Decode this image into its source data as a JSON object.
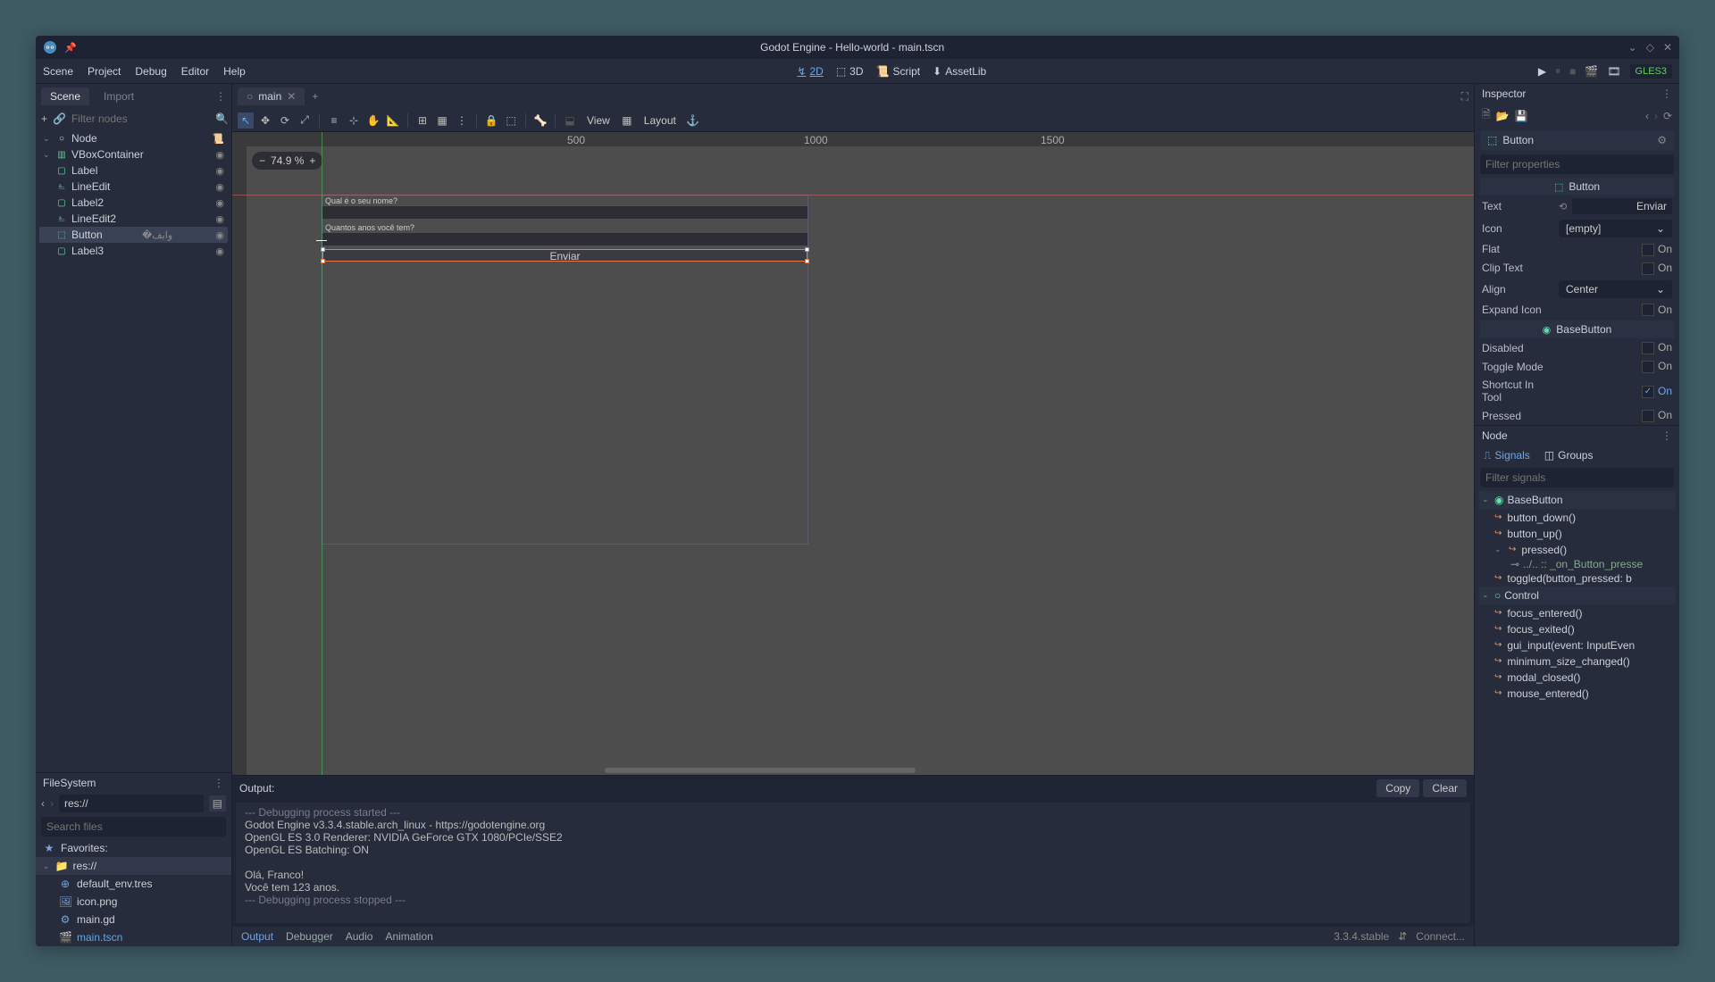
{
  "titlebar": {
    "title": "Godot Engine - Hello-world - main.tscn"
  },
  "menubar": {
    "scene": "Scene",
    "project": "Project",
    "debug": "Debug",
    "editor": "Editor",
    "help": "Help",
    "mode_2d": "2D",
    "mode_3d": "3D",
    "script": "Script",
    "assetlib": "AssetLib",
    "renderer": "GLES3"
  },
  "scene_dock": {
    "tab_scene": "Scene",
    "tab_import": "Import",
    "filter_placeholder": "Filter nodes",
    "tree": {
      "root": "Node",
      "vbox": "VBoxContainer",
      "label": "Label",
      "lineedit": "LineEdit",
      "label2": "Label2",
      "lineedit2": "LineEdit2",
      "button": "Button",
      "label3": "Label3"
    }
  },
  "filesystem": {
    "header": "FileSystem",
    "path": "res://",
    "search_placeholder": "Search files",
    "favorites": "Favorites:",
    "res": "res://",
    "files": {
      "default_env": "default_env.tres",
      "icon": "icon.png",
      "main_gd": "main.gd",
      "main_tscn": "main.tscn"
    }
  },
  "center": {
    "tab_main": "main",
    "view_label": "View",
    "layout_label": "Layout",
    "zoom": "74.9 %",
    "ruler_500": "500",
    "ruler_1000": "1000",
    "ruler_1500": "1500",
    "canvas": {
      "label1": "Qual é o seu nome?",
      "label2": "Quantos anos você tem?",
      "button": "Enviar"
    }
  },
  "output": {
    "header": "Output:",
    "copy": "Copy",
    "clear": "Clear",
    "lines": {
      "l1": "--- Debugging process started ---",
      "l2": "Godot Engine v3.3.4.stable.arch_linux - https://godotengine.org",
      "l3": "OpenGL ES 3.0 Renderer: NVIDIA GeForce GTX 1080/PCIe/SSE2",
      "l4": "OpenGL ES Batching: ON",
      "l5": "",
      "l6": "Olá, Franco!",
      "l7": "Você tem 123 anos.",
      "l8": "--- Debugging process stopped ---"
    }
  },
  "bottom_tabs": {
    "output": "Output",
    "debugger": "Debugger",
    "audio": "Audio",
    "animation": "Animation",
    "version": "3.3.4.stable",
    "connect": "Connect..."
  },
  "inspector": {
    "header": "Inspector",
    "node_name": "Button",
    "filter_placeholder": "Filter properties",
    "section_button": "Button",
    "section_basebutton": "BaseButton",
    "props": {
      "text": "Text",
      "text_val": "Enviar",
      "icon": "Icon",
      "icon_val": "[empty]",
      "flat": "Flat",
      "on": "On",
      "clip_text": "Clip Text",
      "align": "Align",
      "align_val": "Center",
      "expand_icon": "Expand Icon",
      "disabled": "Disabled",
      "toggle_mode": "Toggle Mode",
      "shortcut_in_tool": "Shortcut In Tool",
      "pressed": "Pressed"
    }
  },
  "node_dock": {
    "header": "Node",
    "signals": "Signals",
    "groups": "Groups",
    "filter_placeholder": "Filter signals",
    "basebutton": "BaseButton",
    "button_down": "button_down()",
    "button_up": "button_up()",
    "pressed": "pressed()",
    "conn": "../.. :: _on_Button_presse",
    "toggled": "toggled(button_pressed: b",
    "control": "Control",
    "focus_entered": "focus_entered()",
    "focus_exited": "focus_exited()",
    "gui_input": "gui_input(event: InputEven",
    "min_size": "minimum_size_changed()",
    "modal_closed": "modal_closed()",
    "mouse_entered": "mouse_entered()"
  }
}
